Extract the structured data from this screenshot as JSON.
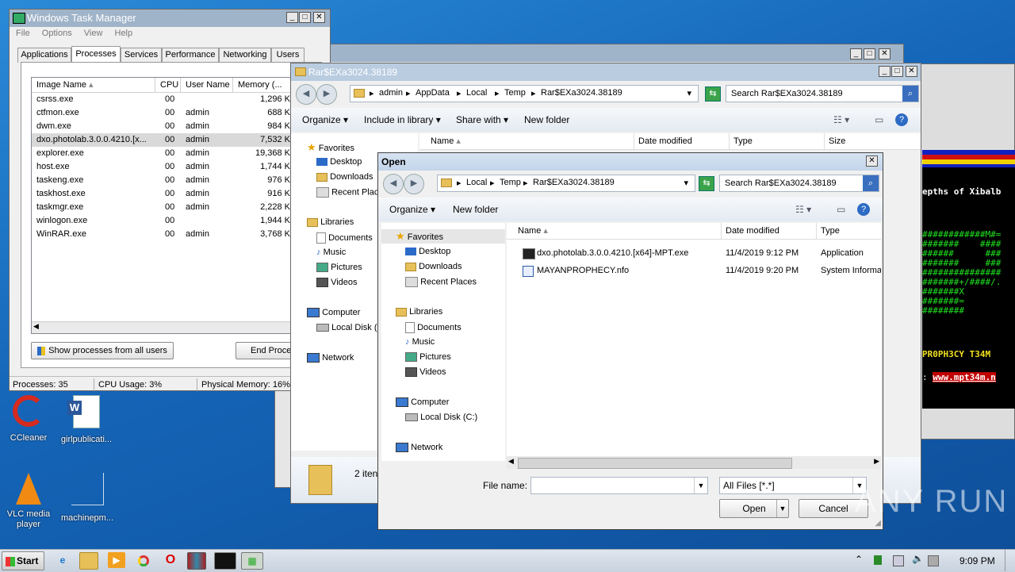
{
  "desktop": {
    "icons": [
      {
        "label": "CCleaner"
      },
      {
        "label": "girlpublicati..."
      },
      {
        "label": "VLC media player"
      },
      {
        "label": "machinepm..."
      }
    ]
  },
  "taskmgr": {
    "title": "Windows Task Manager",
    "menu": [
      "File",
      "Options",
      "View",
      "Help"
    ],
    "tabs": [
      "Applications",
      "Processes",
      "Services",
      "Performance",
      "Networking",
      "Users"
    ],
    "columns": [
      "Image Name",
      "CPU",
      "User Name",
      "Memory (..."
    ],
    "processes": [
      {
        "name": "csrss.exe",
        "cpu": "00",
        "user": "",
        "mem": "1,296 K"
      },
      {
        "name": "ctfmon.exe",
        "cpu": "00",
        "user": "admin",
        "mem": "688 K"
      },
      {
        "name": "dwm.exe",
        "cpu": "00",
        "user": "admin",
        "mem": "984 K"
      },
      {
        "name": "dxo.photolab.3.0.0.4210.[x...",
        "cpu": "00",
        "user": "admin",
        "mem": "7,532 K"
      },
      {
        "name": "explorer.exe",
        "cpu": "00",
        "user": "admin",
        "mem": "19,368 K"
      },
      {
        "name": "host.exe",
        "cpu": "00",
        "user": "admin",
        "mem": "1,744 K"
      },
      {
        "name": "taskeng.exe",
        "cpu": "00",
        "user": "admin",
        "mem": "976 K"
      },
      {
        "name": "taskhost.exe",
        "cpu": "00",
        "user": "admin",
        "mem": "916 K"
      },
      {
        "name": "taskmgr.exe",
        "cpu": "00",
        "user": "admin",
        "mem": "2,228 K"
      },
      {
        "name": "winlogon.exe",
        "cpu": "00",
        "user": "",
        "mem": "1,944 K"
      },
      {
        "name": "WinRAR.exe",
        "cpu": "00",
        "user": "admin",
        "mem": "3,768 K"
      }
    ],
    "show_all_button": "Show processes from all users",
    "end_process_button": "End Proce",
    "status": {
      "processes": "Processes: 35",
      "cpu": "CPU Usage: 3%",
      "memory": "Physical Memory: 16%"
    }
  },
  "explorer": {
    "title": "Rar$EXa3024.38189",
    "breadcrumb": [
      "admin",
      "AppData",
      "Local",
      "Temp",
      "Rar$EXa3024.38189"
    ],
    "search_placeholder": "Search Rar$EXa3024.38189",
    "toolbar": [
      "Organize",
      "Include in library",
      "Share with",
      "New folder"
    ],
    "columns": [
      "Name",
      "Date modified",
      "Type",
      "Size"
    ],
    "nav": {
      "favorites": "Favorites",
      "desktop": "Desktop",
      "downloads": "Downloads",
      "recent": "Recent Plac",
      "libraries": "Libraries",
      "documents": "Documents",
      "music": "Music",
      "pictures": "Pictures",
      "videos": "Videos",
      "computer": "Computer",
      "localdisk": "Local Disk (C",
      "network": "Network"
    },
    "items_count": "2 iten"
  },
  "console": {
    "line1": "epths of Xibalb",
    "art": [
      "############M#=",
      "#######    ####",
      "######      ###",
      "#######     ###",
      "###############",
      "#######+/####/.",
      "#######X",
      "#######=",
      "########"
    ],
    "line_title": "PR0PH3CY T34M",
    "url_prefix": ":",
    "url": "www.mpt34m.n"
  },
  "open_dialog": {
    "title": "Open",
    "breadcrumb": [
      "Local",
      "Temp",
      "Rar$EXa3024.38189"
    ],
    "search_placeholder": "Search Rar$EXa3024.38189",
    "toolbar": [
      "Organize",
      "New folder"
    ],
    "columns": [
      "Name",
      "Date modified",
      "Type"
    ],
    "nav": {
      "favorites": "Favorites",
      "desktop": "Desktop",
      "downloads": "Downloads",
      "recent": "Recent Places",
      "libraries": "Libraries",
      "documents": "Documents",
      "music": "Music",
      "pictures": "Pictures",
      "videos": "Videos",
      "computer": "Computer",
      "localdisk": "Local Disk (C:)",
      "network": "Network"
    },
    "files": [
      {
        "name": "dxo.photolab.3.0.0.4210.[x64]-MPT.exe",
        "date": "11/4/2019 9:12 PM",
        "type": "Application"
      },
      {
        "name": "MAYANPROPHECY.nfo",
        "date": "11/4/2019 9:20 PM",
        "type": "System Informa"
      }
    ],
    "filename_label": "File name:",
    "filename_value": "",
    "filetype_value": "All Files [*.*]",
    "open_button": "Open",
    "cancel_button": "Cancel"
  },
  "taskbar": {
    "start_label": "Start",
    "clock": "9:09 PM"
  },
  "watermark": "ANY RUN"
}
